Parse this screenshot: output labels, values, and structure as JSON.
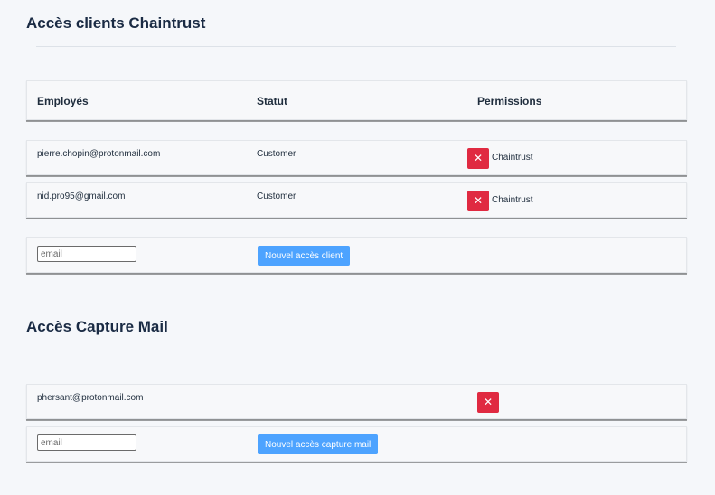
{
  "clients_section": {
    "title": "Accès clients Chaintrust",
    "headers": {
      "employees": "Employés",
      "status": "Statut",
      "permissions": "Permissions"
    },
    "rows": [
      {
        "email": "pierre.chopin@protonmail.com",
        "status": "Customer",
        "permission": "Chaintrust"
      },
      {
        "email": "nid.pro95@gmail.com",
        "status": "Customer",
        "permission": "Chaintrust"
      }
    ],
    "email_placeholder": "email",
    "add_button_label": "Nouvel accès client"
  },
  "capture_section": {
    "title": "Accès Capture Mail",
    "rows": [
      {
        "email": "phersant@protonmail.com"
      }
    ],
    "email_placeholder": "email",
    "add_button_label": "Nouvel accès capture mail"
  },
  "icons": {
    "delete": "close-icon",
    "delete_glyph": "✕"
  },
  "colors": {
    "danger": "#e02a41",
    "primary": "#4da3ff",
    "background": "#f5f7fa"
  }
}
